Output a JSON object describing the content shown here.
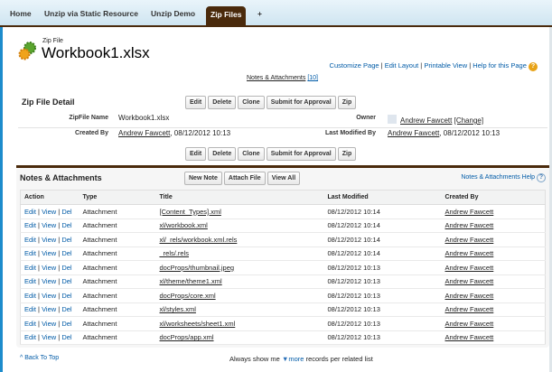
{
  "tabs": [
    {
      "label": "Home"
    },
    {
      "label": "Unzip via Static Resource"
    },
    {
      "label": "Unzip Demo"
    },
    {
      "label": "Zip Files",
      "active": true
    },
    {
      "label": "+"
    }
  ],
  "header": {
    "object_type": "Zip File",
    "title": "Workbook1.xlsx",
    "links": [
      "Customize Page",
      "Edit Layout",
      "Printable View",
      "Help for this Page"
    ],
    "related_link": "Notes & Attachments",
    "related_count": "[10]"
  },
  "detail": {
    "title": "Zip File Detail",
    "buttons": [
      "Edit",
      "Delete",
      "Clone",
      "Submit for Approval",
      "Zip"
    ],
    "fields": {
      "name_label": "ZipFile Name",
      "name_value": "Workbook1.xlsx",
      "owner_label": "Owner",
      "owner_value": "Andrew Fawcett",
      "owner_change": "[Change]",
      "created_label": "Created By",
      "created_user": "Andrew Fawcett",
      "created_date": ", 08/12/2012 10:13",
      "modified_label": "Last Modified By",
      "modified_user": "Andrew Fawcett",
      "modified_date": ", 08/12/2012 10:13"
    }
  },
  "notes": {
    "title": "Notes & Attachments",
    "buttons": [
      "New Note",
      "Attach File",
      "View All"
    ],
    "help": "Notes & Attachments Help",
    "columns": [
      "Action",
      "Type",
      "Title",
      "Last Modified",
      "Created By"
    ],
    "actions": [
      "Edit",
      "View",
      "Del"
    ],
    "rows": [
      {
        "type": "Attachment",
        "title": "[Content_Types].xml",
        "modified": "08/12/2012 10:14",
        "created_by": "Andrew Fawcett"
      },
      {
        "type": "Attachment",
        "title": "xl/workbook.xml",
        "modified": "08/12/2012 10:14",
        "created_by": "Andrew Fawcett"
      },
      {
        "type": "Attachment",
        "title": "xl/_rels/workbook.xml.rels",
        "modified": "08/12/2012 10:14",
        "created_by": "Andrew Fawcett"
      },
      {
        "type": "Attachment",
        "title": "_rels/.rels",
        "modified": "08/12/2012 10:14",
        "created_by": "Andrew Fawcett"
      },
      {
        "type": "Attachment",
        "title": "docProps/thumbnail.jpeg",
        "modified": "08/12/2012 10:13",
        "created_by": "Andrew Fawcett"
      },
      {
        "type": "Attachment",
        "title": "xl/theme/theme1.xml",
        "modified": "08/12/2012 10:13",
        "created_by": "Andrew Fawcett"
      },
      {
        "type": "Attachment",
        "title": "docProps/core.xml",
        "modified": "08/12/2012 10:13",
        "created_by": "Andrew Fawcett"
      },
      {
        "type": "Attachment",
        "title": "xl/styles.xml",
        "modified": "08/12/2012 10:13",
        "created_by": "Andrew Fawcett"
      },
      {
        "type": "Attachment",
        "title": "xl/worksheets/sheet1.xml",
        "modified": "08/12/2012 10:13",
        "created_by": "Andrew Fawcett"
      },
      {
        "type": "Attachment",
        "title": "docProps/app.xml",
        "modified": "08/12/2012 10:13",
        "created_by": "Andrew Fawcett"
      }
    ]
  },
  "footer": {
    "back_to_top": "Back To Top",
    "always_show": "Always show me",
    "more": "more",
    "records_text": "records per related list"
  }
}
